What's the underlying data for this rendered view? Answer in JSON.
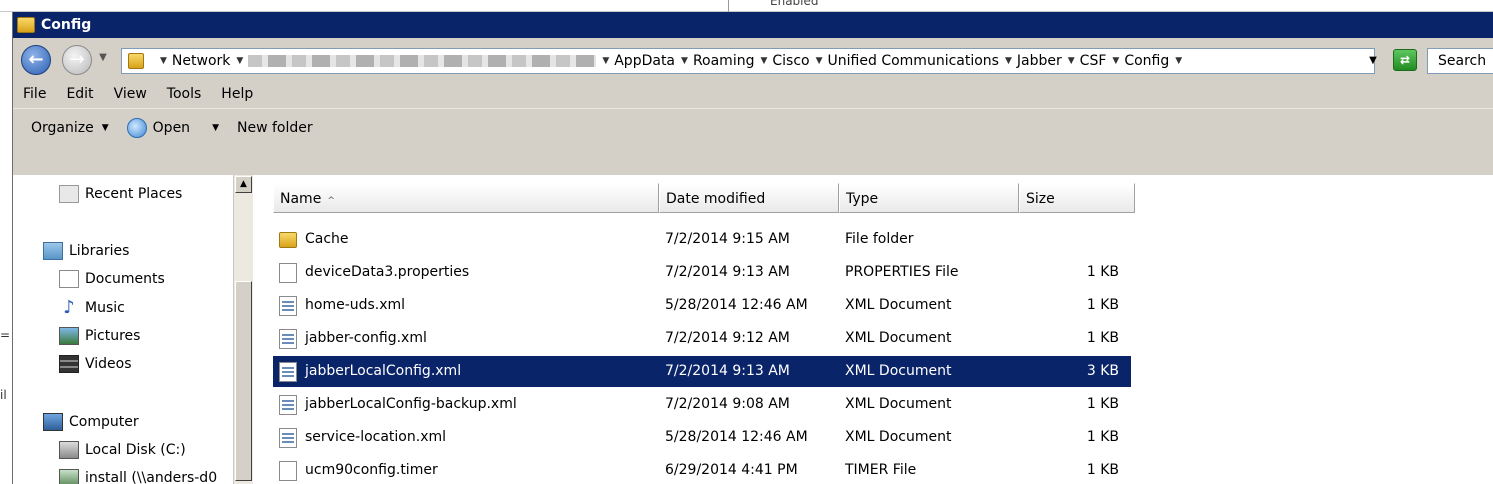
{
  "background": {
    "partial_label": "Enabled"
  },
  "window": {
    "title": "Config"
  },
  "address": {
    "crumbs": [
      "Network",
      "AppData",
      "Roaming",
      "Cisco",
      "Unified Communications",
      "Jabber",
      "CSF",
      "Config"
    ],
    "search_placeholder": "Search"
  },
  "menu": {
    "items": [
      "File",
      "Edit",
      "View",
      "Tools",
      "Help"
    ]
  },
  "toolbar": {
    "organize": "Organize",
    "open": "Open",
    "new_folder": "New folder"
  },
  "nav": {
    "recent_places": "Recent Places",
    "libraries": "Libraries",
    "documents": "Documents",
    "music": "Music",
    "pictures": "Pictures",
    "videos": "Videos",
    "computer": "Computer",
    "local_disk": "Local Disk (C:)",
    "install": "install (\\\\anders-d0"
  },
  "columns": {
    "name": "Name",
    "date": "Date modified",
    "type": "Type",
    "size": "Size"
  },
  "files": [
    {
      "name": "Cache",
      "date": "7/2/2014 9:15 AM",
      "type": "File folder",
      "size": "",
      "icon": "folder-icon"
    },
    {
      "name": "deviceData3.properties",
      "date": "7/2/2014 9:13 AM",
      "type": "PROPERTIES File",
      "size": "1 KB",
      "icon": "file-icon"
    },
    {
      "name": "home-uds.xml",
      "date": "5/28/2014 12:46 AM",
      "type": "XML Document",
      "size": "1 KB",
      "icon": "xml-file-icon"
    },
    {
      "name": "jabber-config.xml",
      "date": "7/2/2014 9:12 AM",
      "type": "XML Document",
      "size": "1 KB",
      "icon": "xml-file-icon"
    },
    {
      "name": "jabberLocalConfig.xml",
      "date": "7/2/2014 9:13 AM",
      "type": "XML Document",
      "size": "3 KB",
      "icon": "xml-file-icon",
      "selected": true
    },
    {
      "name": "jabberLocalConfig-backup.xml",
      "date": "7/2/2014 9:08 AM",
      "type": "XML Document",
      "size": "1 KB",
      "icon": "xml-file-icon"
    },
    {
      "name": "service-location.xml",
      "date": "5/28/2014 12:46 AM",
      "type": "XML Document",
      "size": "1 KB",
      "icon": "xml-file-icon"
    },
    {
      "name": "ucm90config.timer",
      "date": "6/29/2014 4:41 PM",
      "type": "TIMER File",
      "size": "1 KB",
      "icon": "file-icon"
    }
  ],
  "colors": {
    "titlebar": "#0a246a",
    "selection": "#0a246a",
    "chrome": "#d4d0c8"
  }
}
